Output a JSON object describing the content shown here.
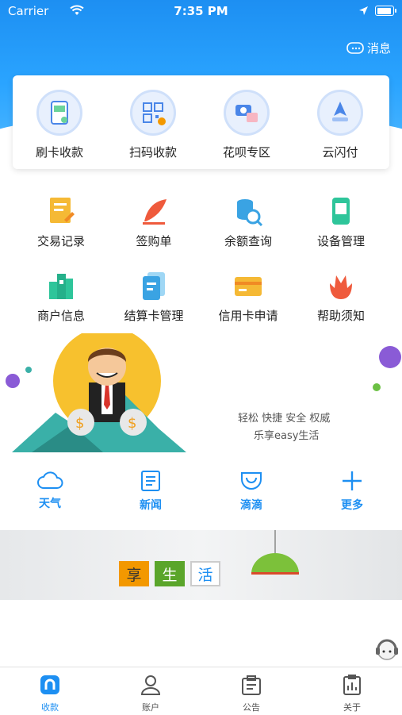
{
  "status": {
    "carrier": "Carrier",
    "time": "7:35 PM"
  },
  "header": {
    "message_label": "消息"
  },
  "card": {
    "items": [
      {
        "label": "刷卡收款",
        "icon": "card-swipe-icon"
      },
      {
        "label": "扫码收款",
        "icon": "qr-scan-icon"
      },
      {
        "label": "花呗专区",
        "icon": "huabei-icon"
      },
      {
        "label": "云闪付",
        "icon": "cloud-pay-icon"
      }
    ]
  },
  "grid": {
    "items": [
      {
        "label": "交易记录",
        "icon": "transaction-record-icon"
      },
      {
        "label": "签购单",
        "icon": "sign-slip-icon"
      },
      {
        "label": "余额查询",
        "icon": "balance-query-icon"
      },
      {
        "label": "设备管理",
        "icon": "device-manage-icon"
      },
      {
        "label": "商户信息",
        "icon": "merchant-info-icon"
      },
      {
        "label": "结算卡管理",
        "icon": "settlement-card-icon"
      },
      {
        "label": "信用卡申请",
        "icon": "credit-card-apply-icon"
      },
      {
        "label": "帮助须知",
        "icon": "help-notice-icon"
      }
    ]
  },
  "banner": {
    "slogan1": "轻松 快捷 安全 权威",
    "slogan2": "乐享easy生活"
  },
  "quick": {
    "items": [
      {
        "label": "天气",
        "icon": "weather-icon"
      },
      {
        "label": "新闻",
        "icon": "news-icon"
      },
      {
        "label": "滴滴",
        "icon": "didi-icon"
      },
      {
        "label": "更多",
        "icon": "plus-icon"
      }
    ]
  },
  "life": {
    "tiles": [
      "享",
      "生",
      "活"
    ]
  },
  "tabbar": {
    "items": [
      {
        "label": "收款",
        "icon": "home-icon"
      },
      {
        "label": "账户",
        "icon": "user-icon"
      },
      {
        "label": "公告",
        "icon": "notice-icon"
      },
      {
        "label": "关于",
        "icon": "about-icon"
      }
    ]
  },
  "colors": {
    "accent": "#1d8ff2",
    "orange": "#f39800",
    "green": "#5aa52a"
  }
}
